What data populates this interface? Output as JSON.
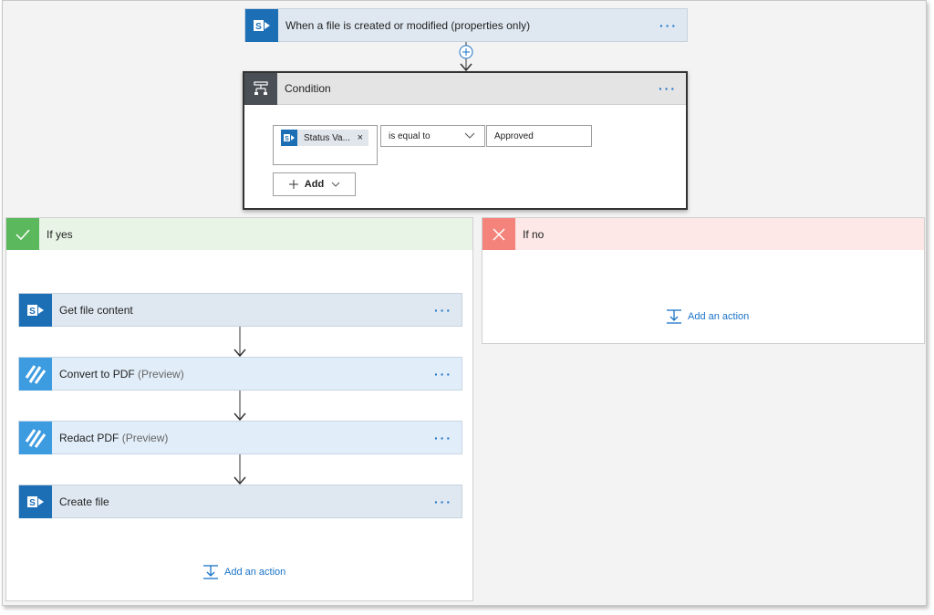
{
  "trigger": {
    "title": "When a file is created or modified (properties only)",
    "icon": "sharepoint-icon",
    "menu": "···"
  },
  "insert_step": {
    "icon": "plus-circle-icon"
  },
  "condition": {
    "title": "Condition",
    "icon": "condition-icon",
    "menu": "···",
    "token_label": "Status Va...",
    "token_remove": "×",
    "operator": "is equal to",
    "value": "Approved",
    "add_label": "Add"
  },
  "if_yes": {
    "label": "If yes",
    "color": "#5cb85c",
    "actions": [
      {
        "title": "Get file content",
        "suffix": "",
        "icon": "sharepoint-icon",
        "menu": "···"
      },
      {
        "title": "Convert to PDF",
        "suffix": "(Preview)",
        "icon": "encodian-icon",
        "menu": "···"
      },
      {
        "title": "Redact PDF",
        "suffix": "(Preview)",
        "icon": "encodian-icon",
        "menu": "···"
      },
      {
        "title": "Create file",
        "suffix": "",
        "icon": "sharepoint-icon",
        "menu": "···"
      }
    ],
    "add_action": "Add an action"
  },
  "if_no": {
    "label": "If no",
    "color": "#f4837b",
    "add_action": "Add an action"
  }
}
